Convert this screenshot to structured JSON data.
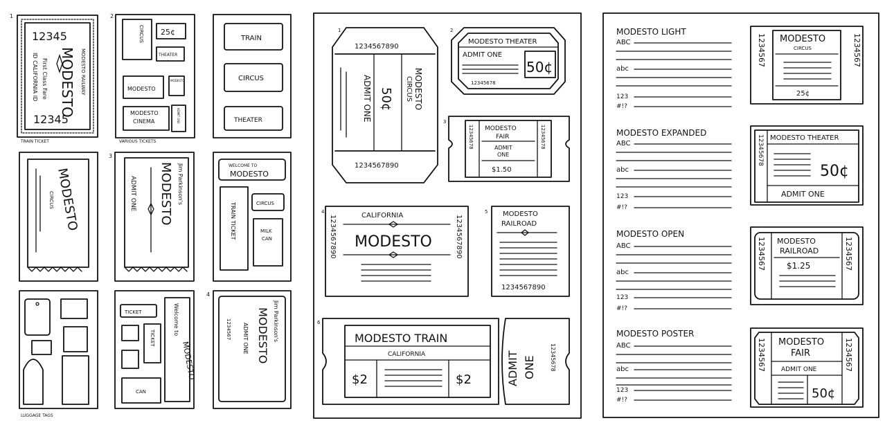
{
  "sheet1": {
    "nums": [
      "1",
      "2",
      "3",
      "4"
    ],
    "captions": {
      "train": "TRAIN TICKET",
      "various": "VARIOUS TICKETS",
      "luggage": "LUGGAGE TAGS"
    },
    "train_ticket": {
      "num_top": "12345",
      "num_bottom": "12345",
      "center": "MODESTO",
      "left_text": "First Class Fare",
      "left_text2": "ID CALIFORNIA ID",
      "right_text": "MODESTO RAILWAY"
    },
    "various": {
      "circus": "CIRCUS",
      "price": "25¢",
      "theater": "THEATER",
      "modesto": "MODESTO",
      "cinema_top": "MODESTO",
      "cinema_bottom": "CINEMA",
      "small_a": "MODESTO",
      "small_b": "ADMIT ONE"
    },
    "list": {
      "train": "TRAIN",
      "circus": "CIRCUS",
      "theater": "THEATER"
    },
    "circus_ticket": {
      "title": "MODESTO",
      "sub": "CIRCUS"
    },
    "jim_ticket": {
      "top": "Jim Parkinson's",
      "main": "MODESTO",
      "side": "ADMIT ONE"
    },
    "welcome": {
      "banner_top": "WELCOME TO",
      "banner_main": "MODESTO",
      "train": "TRAIN TICKET",
      "circus": "CIRCUS",
      "milk1": "MILK",
      "milk2": "CAN"
    },
    "tickets_mix": {
      "ticket": "TICKET",
      "ticket2": "TICKET",
      "can": "CAN",
      "welcome": "Welcome to",
      "modesto": "MODESTO"
    },
    "jim2": {
      "top": "Jim Parkinson's",
      "main": "MODESTO",
      "side": "ADMIT ONE",
      "nums": "1234567"
    }
  },
  "sheet2": {
    "nums": [
      "1",
      "2",
      "3",
      "4",
      "5",
      "6"
    ],
    "t1": {
      "top": "1234567890",
      "bottom": "1234567890",
      "modesto": "MODESTO",
      "circus": "CIRCUS",
      "price": "50¢",
      "admit": "ADMIT ONE"
    },
    "t2": {
      "title": "MODESTO THEATER",
      "admit": "ADMIT ONE",
      "price": "50¢",
      "nums": "12345678"
    },
    "t3": {
      "l1": "MODESTO",
      "l2": "FAIR",
      "l3": "ADMIT",
      "l4": "ONE",
      "price": "$1.50",
      "nums": "12345678"
    },
    "t4": {
      "top": "CALIFORNIA",
      "main": "MODESTO",
      "nums": "1234567890"
    },
    "t5": {
      "l1": "MODESTO",
      "l2": "RAILROAD",
      "nums": "1234567890"
    },
    "t6": {
      "title": "MODESTO TRAIN",
      "sub": "CALIFORNIA",
      "price_l": "$2",
      "price_r": "$2",
      "admit1": "ADMIT",
      "admit2": "ONE",
      "nums": "12345678"
    }
  },
  "sheet3": {
    "specimens": [
      {
        "name": "MODESTO LIGHT",
        "abc_upper": "ABC",
        "abc_lower": "abc",
        "digits": "123",
        "symbols": "#!?"
      },
      {
        "name": "MODESTO EXPANDED",
        "abc_upper": "ABC",
        "abc_lower": "abc",
        "digits": "123",
        "symbols": "#!?"
      },
      {
        "name": "MODESTO OPEN",
        "abc_upper": "ABC",
        "abc_lower": "abc",
        "digits": "123",
        "symbols": "#!?"
      },
      {
        "name": "MODESTO POSTER",
        "abc_upper": "ABC",
        "abc_lower": "abc",
        "digits": "123",
        "symbols": "#!?"
      }
    ],
    "tickets": [
      {
        "title": "MODESTO",
        "sub": "CIRCUS",
        "price": "25¢",
        "nums": "1234567"
      },
      {
        "title": "MODESTO THEATER",
        "price": "50¢",
        "admit": "ADMIT ONE",
        "nums": "12345678"
      },
      {
        "title": "MODESTO",
        "sub": "RAILROAD",
        "price": "$1.25",
        "nums": "1234567"
      },
      {
        "title": "MODESTO",
        "sub": "FAIR",
        "admit": "ADMIT ONE",
        "price": "50¢",
        "nums": "1234567"
      }
    ]
  }
}
